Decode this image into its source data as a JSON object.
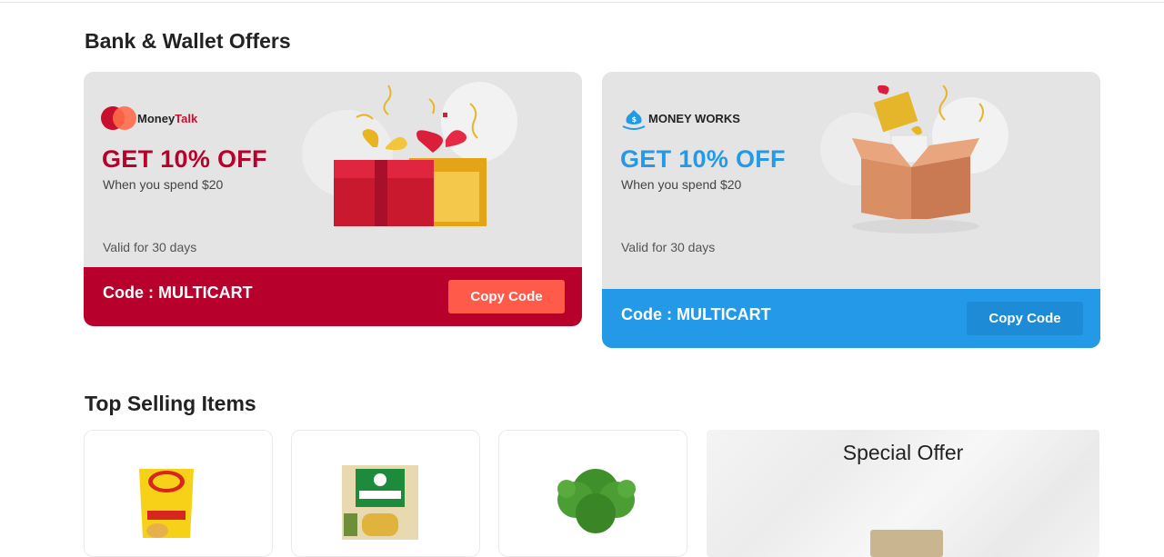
{
  "sections": {
    "bank_offers_title": "Bank & Wallet Offers",
    "top_selling_title": "Top Selling Items"
  },
  "offers": [
    {
      "brand_icon": "overlapping-circles-icon",
      "brand_part1": "Money",
      "brand_part2": "Talk",
      "headline": "GET 10% OFF",
      "subtext": "When you spend $20",
      "validity": "Valid for 30 days",
      "code_text": "Code : MULTICART",
      "button_label": "Copy Code",
      "theme_color": "#b8002c",
      "button_color": "#ff5a4a"
    },
    {
      "brand_icon": "money-bag-icon",
      "brand_part1": "MONEY WORKS",
      "headline": "GET 10% OFF",
      "subtext": "When you spend $20",
      "validity": "Valid for 30 days",
      "code_text": "Code : MULTICART",
      "button_label": "Copy Code",
      "theme_color": "#2499e8",
      "button_color": "#1e8bd6"
    }
  ],
  "products": [
    {
      "image": "lays-chips-bag-image"
    },
    {
      "image": "nithara-tea-pack-image"
    },
    {
      "image": "coriander-bunch-image"
    }
  ],
  "special_offer": {
    "title": "Special Offer"
  }
}
